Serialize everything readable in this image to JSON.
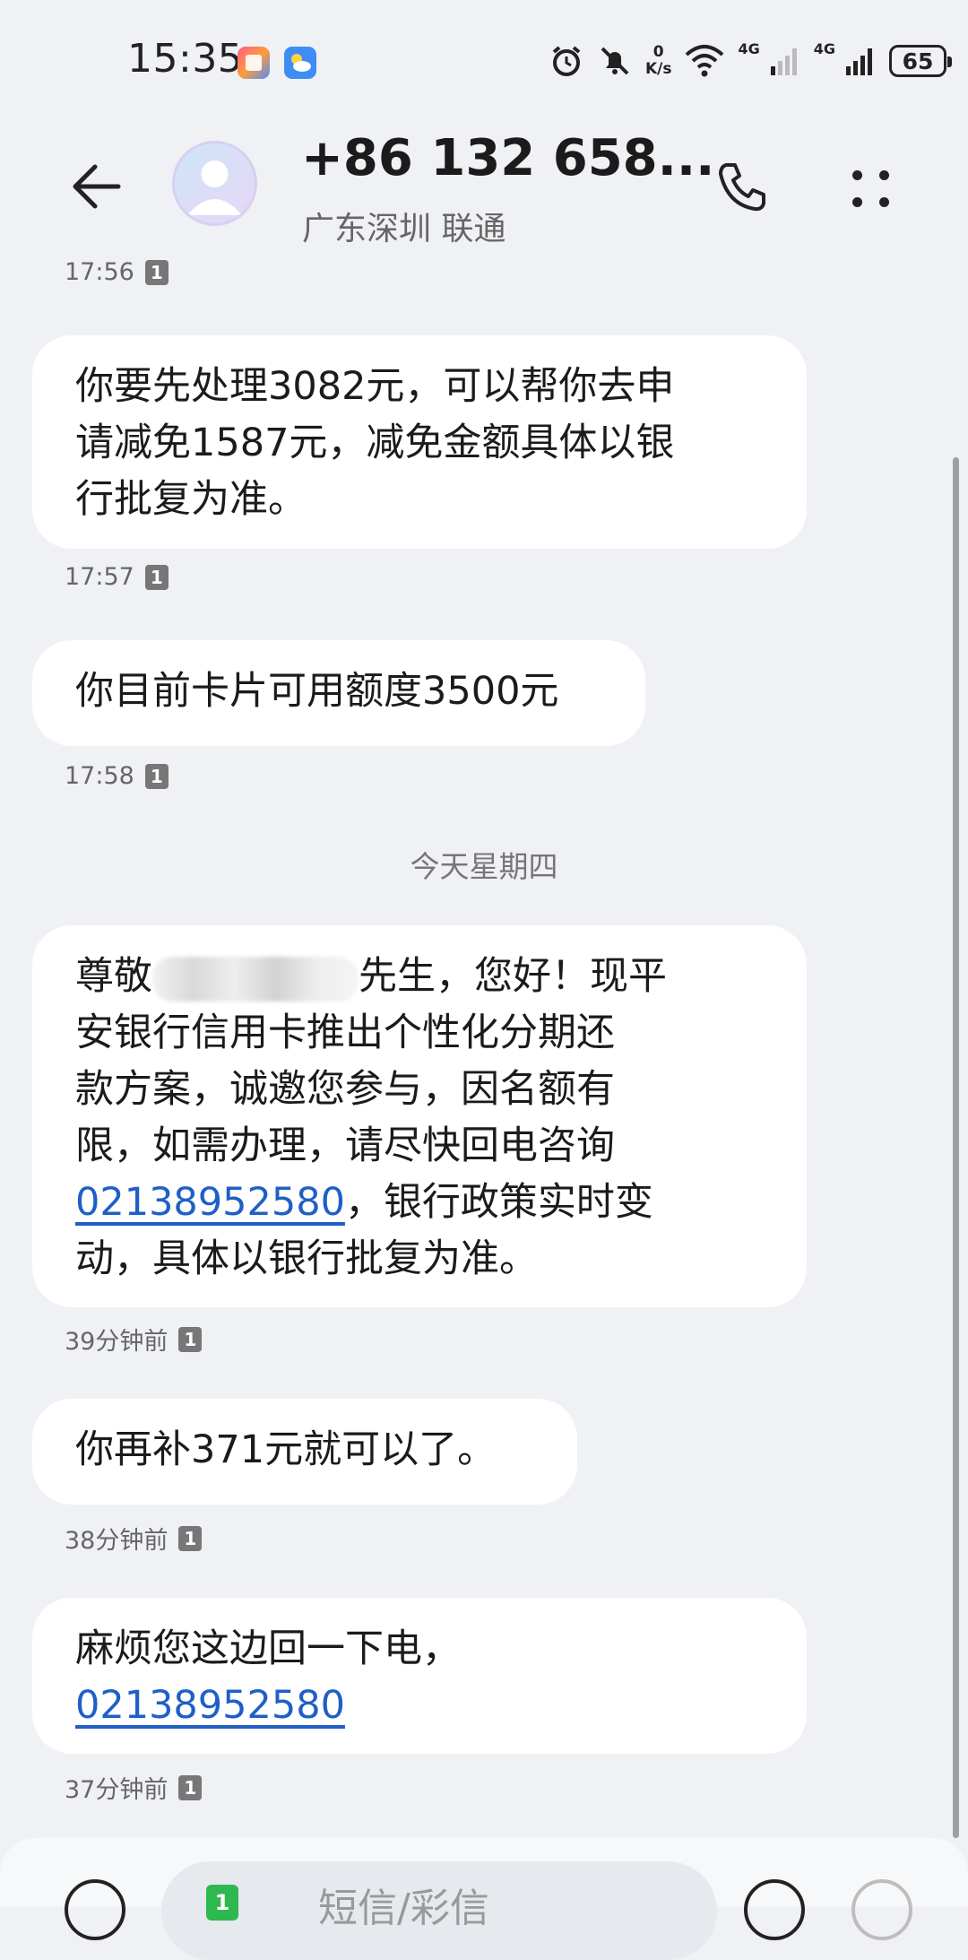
{
  "status_bar": {
    "time": "15:35",
    "net_speed_value": "0",
    "net_speed_unit": "K/s",
    "sim1_label": "4G",
    "sim2_label": "4G",
    "battery": "65",
    "icons": [
      "app-store-icon",
      "weather-icon",
      "alarm-icon",
      "mute-icon",
      "wifi-icon",
      "signal-icon",
      "battery-icon"
    ]
  },
  "header": {
    "contact_number": "+86 132 658...",
    "contact_location": "广东深圳 联通",
    "icons": [
      "back-arrow-icon",
      "avatar",
      "phone-icon",
      "more-icon"
    ]
  },
  "messages": [
    {
      "time": "17:56",
      "sim": "1"
    },
    {
      "text": "你要先处理3082元，可以帮你去申请减免1587元，减免金额具体以银行批复为准。",
      "line1": "你要先处理3082元，可以帮你去申",
      "line2": "请减免1587元，减免金额具体以银",
      "line3": "行批复为准。",
      "time": "17:57",
      "sim": "1"
    },
    {
      "text": "你目前卡片可用额度3500元",
      "time": "17:58",
      "sim": "1"
    },
    {
      "line1_a": "尊敬",
      "line1_b": "先生，您好！现平",
      "line2": "安银行信用卡推出个性化分期还",
      "line3": "款方案，诚邀您参与，因名额有",
      "line4": "限，如需办理，请尽快回电咨询",
      "link": "02138952580",
      "line5_rest": "，银行政策实时变",
      "line6": "动，具体以银行批复为准。",
      "time": "39分钟前",
      "sim": "1"
    },
    {
      "text": "你再补371元就可以了。",
      "time": "38分钟前",
      "sim": "1"
    },
    {
      "line1": "麻烦您这边回一下电，",
      "link": "02138952580",
      "time": "37分钟前",
      "sim": "1"
    }
  ],
  "day_separator": "今天星期四",
  "composer": {
    "sim": "1",
    "placeholder": "短信/彩信"
  },
  "colors": {
    "background": "#eff1f4",
    "bubble": "#ffffff",
    "link": "#1f5fc6",
    "sim_badge": "#777777"
  }
}
